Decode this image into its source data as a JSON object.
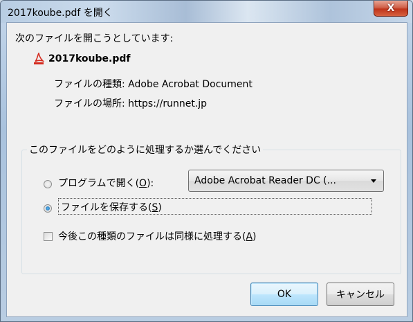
{
  "window": {
    "title": "2017koube.pdf を開く",
    "close_label": "X"
  },
  "dialog": {
    "intro": "次のファイルを開こうとしています:",
    "file_name": "2017koube.pdf",
    "file_type": "ファイルの種類: Adobe Acrobat Document",
    "file_location": "ファイルの場所: https://runnet.jp",
    "group_label": "このファイルをどのように処理するか選んでください",
    "open_with": {
      "label_prefix": "プログラムで開く(",
      "accel": "O",
      "label_suffix": "):",
      "selected_program": "Adobe Acrobat Reader DC (...",
      "checked": false
    },
    "save_file": {
      "label_prefix": "ファイルを保存する(",
      "accel": "S",
      "label_suffix": ")",
      "checked": true
    },
    "remember": {
      "label_prefix": "今後この種類のファイルは同様に処理する(",
      "accel": "A",
      "label_suffix": ")",
      "checked": false
    },
    "ok_label": "OK",
    "cancel_label": "キャンセル"
  },
  "colors": {
    "pdf_icon": "#d42a1e",
    "close_button": "#c0351b",
    "ok_border": "#3c7fb1"
  },
  "icons": {
    "file": "pdf-file-icon",
    "dropdown": "chevron-down-icon",
    "close": "close-icon"
  }
}
